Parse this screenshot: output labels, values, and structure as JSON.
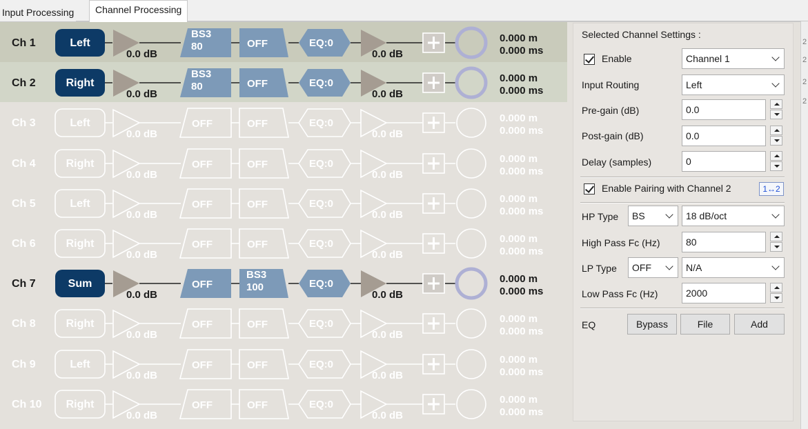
{
  "tabs": [
    {
      "label": "Input Processing",
      "active": false
    },
    {
      "label": "Channel Processing",
      "active": true
    }
  ],
  "right_edge_marks": [
    "2",
    "2",
    "2",
    "2"
  ],
  "channels": [
    {
      "name": "Ch 1",
      "active": true,
      "selected": true,
      "routing": "Left",
      "pre_gain": "0.0 dB",
      "filter1": [
        "BS3",
        "80"
      ],
      "filter2": [
        "OFF"
      ],
      "eq": "EQ:0",
      "post_gain": "0.0 dB",
      "distance": "0.000 m",
      "delay": "0.000 ms"
    },
    {
      "name": "Ch 2",
      "active": true,
      "selected": true,
      "routing": "Right",
      "pre_gain": "0.0 dB",
      "filter1": [
        "BS3",
        "80"
      ],
      "filter2": [
        "OFF"
      ],
      "eq": "EQ:0",
      "post_gain": "0.0 dB",
      "distance": "0.000 m",
      "delay": "0.000 ms"
    },
    {
      "name": "Ch 3",
      "active": false,
      "selected": false,
      "routing": "Left",
      "pre_gain": "0.0 dB",
      "filter1": [
        "OFF"
      ],
      "filter2": [
        "OFF"
      ],
      "eq": "EQ:0",
      "post_gain": "0.0 dB",
      "distance": "0.000 m",
      "delay": "0.000 ms"
    },
    {
      "name": "Ch 4",
      "active": false,
      "selected": false,
      "routing": "Right",
      "pre_gain": "0.0 dB",
      "filter1": [
        "OFF"
      ],
      "filter2": [
        "OFF"
      ],
      "eq": "EQ:0",
      "post_gain": "0.0 dB",
      "distance": "0.000 m",
      "delay": "0.000 ms"
    },
    {
      "name": "Ch 5",
      "active": false,
      "selected": false,
      "routing": "Left",
      "pre_gain": "0.0 dB",
      "filter1": [
        "OFF"
      ],
      "filter2": [
        "OFF"
      ],
      "eq": "EQ:0",
      "post_gain": "0.0 dB",
      "distance": "0.000 m",
      "delay": "0.000 ms"
    },
    {
      "name": "Ch 6",
      "active": false,
      "selected": false,
      "routing": "Right",
      "pre_gain": "0.0 dB",
      "filter1": [
        "OFF"
      ],
      "filter2": [
        "OFF"
      ],
      "eq": "EQ:0",
      "post_gain": "0.0 dB",
      "distance": "0.000 m",
      "delay": "0.000 ms"
    },
    {
      "name": "Ch 7",
      "active": true,
      "selected": false,
      "routing": "Sum",
      "pre_gain": "0.0 dB",
      "filter1": [
        "OFF"
      ],
      "filter2": [
        "BS3",
        "100"
      ],
      "eq": "EQ:0",
      "post_gain": "0.0 dB",
      "distance": "0.000 m",
      "delay": "0.000 ms"
    },
    {
      "name": "Ch 8",
      "active": false,
      "selected": false,
      "routing": "Right",
      "pre_gain": "0.0 dB",
      "filter1": [
        "OFF"
      ],
      "filter2": [
        "OFF"
      ],
      "eq": "EQ:0",
      "post_gain": "0.0 dB",
      "distance": "0.000 m",
      "delay": "0.000 ms"
    },
    {
      "name": "Ch 9",
      "active": false,
      "selected": false,
      "routing": "Left",
      "pre_gain": "0.0 dB",
      "filter1": [
        "OFF"
      ],
      "filter2": [
        "OFF"
      ],
      "eq": "EQ:0",
      "post_gain": "0.0 dB",
      "distance": "0.000 m",
      "delay": "0.000 ms"
    },
    {
      "name": "Ch 10",
      "active": false,
      "selected": false,
      "routing": "Right",
      "pre_gain": "0.0 dB",
      "filter1": [
        "OFF"
      ],
      "filter2": [
        "OFF"
      ],
      "eq": "EQ:0",
      "post_gain": "0.0 dB",
      "distance": "0.000 m",
      "delay": "0.000 ms"
    }
  ],
  "settings": {
    "title": "Selected Channel Settings :",
    "enable_label": "Enable",
    "enable_checked": true,
    "channel_select": "Channel 1",
    "input_routing_label": "Input Routing",
    "input_routing_value": "Left",
    "pre_gain_label": "Pre-gain (dB)",
    "pre_gain_value": "0.0",
    "post_gain_label": "Post-gain (dB)",
    "post_gain_value": "0.0",
    "delay_label": "Delay (samples)",
    "delay_value": "0",
    "pairing_label": "Enable Pairing with Channel 2",
    "pairing_checked": true,
    "pairing_button": "1↔2",
    "hp_type_label": "HP Type",
    "hp_type_value": "BS",
    "hp_slope_value": "18 dB/oct",
    "hp_fc_label": "High Pass Fc (Hz)",
    "hp_fc_value": "80",
    "lp_type_label": "LP Type",
    "lp_type_value": "OFF",
    "lp_slope_value": "N/A",
    "lp_fc_label": "Low Pass Fc (Hz)",
    "lp_fc_value": "2000",
    "eq_label": "EQ",
    "bypass_button": "Bypass",
    "file_button": "File",
    "add_button": "Add"
  },
  "colors": {
    "panel_bg": "#e4e1dc",
    "selected_row_bg": "#c9cbbb",
    "routing_fill": "#0d3a66",
    "block_fill": "#7d9ab8",
    "amp_fill": "#a59c92",
    "ring_stroke": "#aeb0d4",
    "inactive_stroke": "#ffffff"
  }
}
